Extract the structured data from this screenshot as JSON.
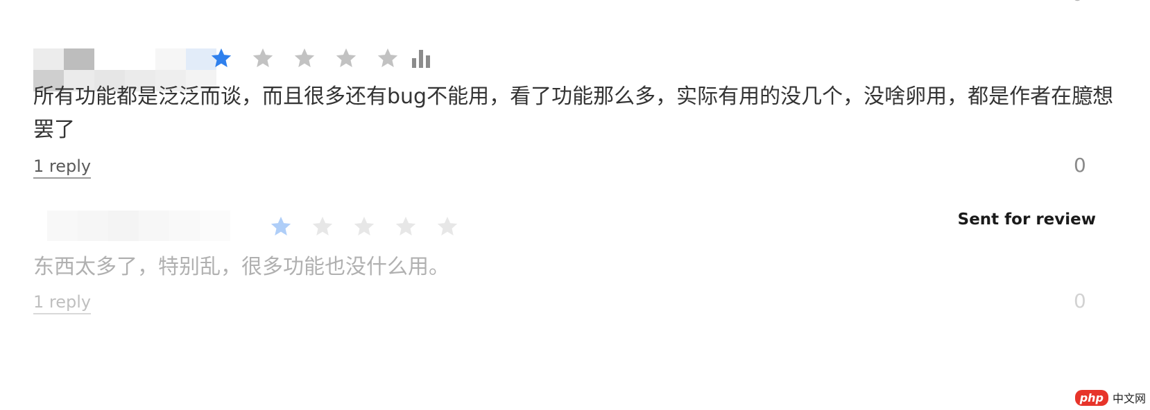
{
  "top_partial_count": "0",
  "reviews": [
    {
      "rating": 1,
      "max_rating": 5,
      "text": "所有功能都是泛泛而谈，而且很多还有bug不能用，看了功能那么多，实际有用的没几个，没啥卵用，都是作者在臆想罢了",
      "reply_link": "1 reply",
      "count": "0"
    },
    {
      "rating": 1,
      "max_rating": 5,
      "status": "Sent for review",
      "text": "东西太多了，特别乱，很多功能也没什么用。",
      "reply_link": "1 reply",
      "count": "0"
    }
  ],
  "colors": {
    "star_filled": "#2f80ed",
    "star_empty": "#c2c2c2"
  },
  "watermark": {
    "logo": "php",
    "text": "中文网"
  }
}
